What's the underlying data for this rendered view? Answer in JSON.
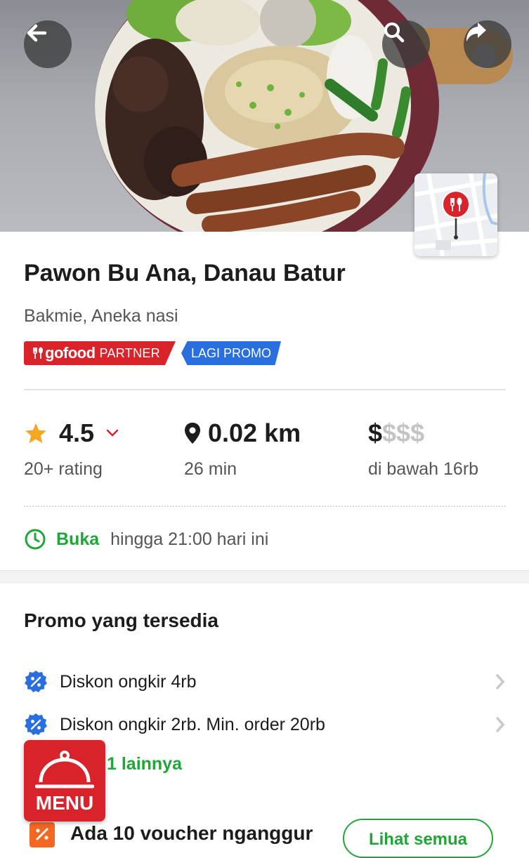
{
  "header": {
    "back_icon": "back-arrow-icon",
    "search_icon": "search-icon",
    "share_icon": "share-icon",
    "map_icon": "restaurant-pin-icon"
  },
  "restaurant": {
    "name": "Pawon Bu Ana, Danau Batur",
    "cuisine": "Bakmie, Aneka nasi",
    "badges": {
      "partner_brand": "gofood",
      "partner_label": "PARTNER",
      "promo": "LAGI PROMO"
    }
  },
  "stats": {
    "rating": "4.5",
    "rating_count": "20+ rating",
    "distance": "0.02 km",
    "time": "26 min",
    "price_level_active": "$",
    "price_level_inactive": "$$$",
    "price_note": "di bawah 16rb"
  },
  "hours": {
    "status": "Buka",
    "detail": "hingga 21:00 hari ini"
  },
  "promo": {
    "title": "Promo yang tersedia",
    "items": [
      {
        "label": "Diskon ongkir 4rb"
      },
      {
        "label": "Diskon ongkir 2rb. Min. order 20rb"
      }
    ],
    "more_label": "1 lainnya"
  },
  "menu_button": {
    "label": "MENU"
  },
  "voucher": {
    "text": "Ada 10 voucher nganggur",
    "see_all": "Lihat semua"
  },
  "colors": {
    "brand_red": "#d8232a",
    "green": "#1fa637",
    "blue": "#2a6fe0",
    "star": "#f5a623"
  }
}
